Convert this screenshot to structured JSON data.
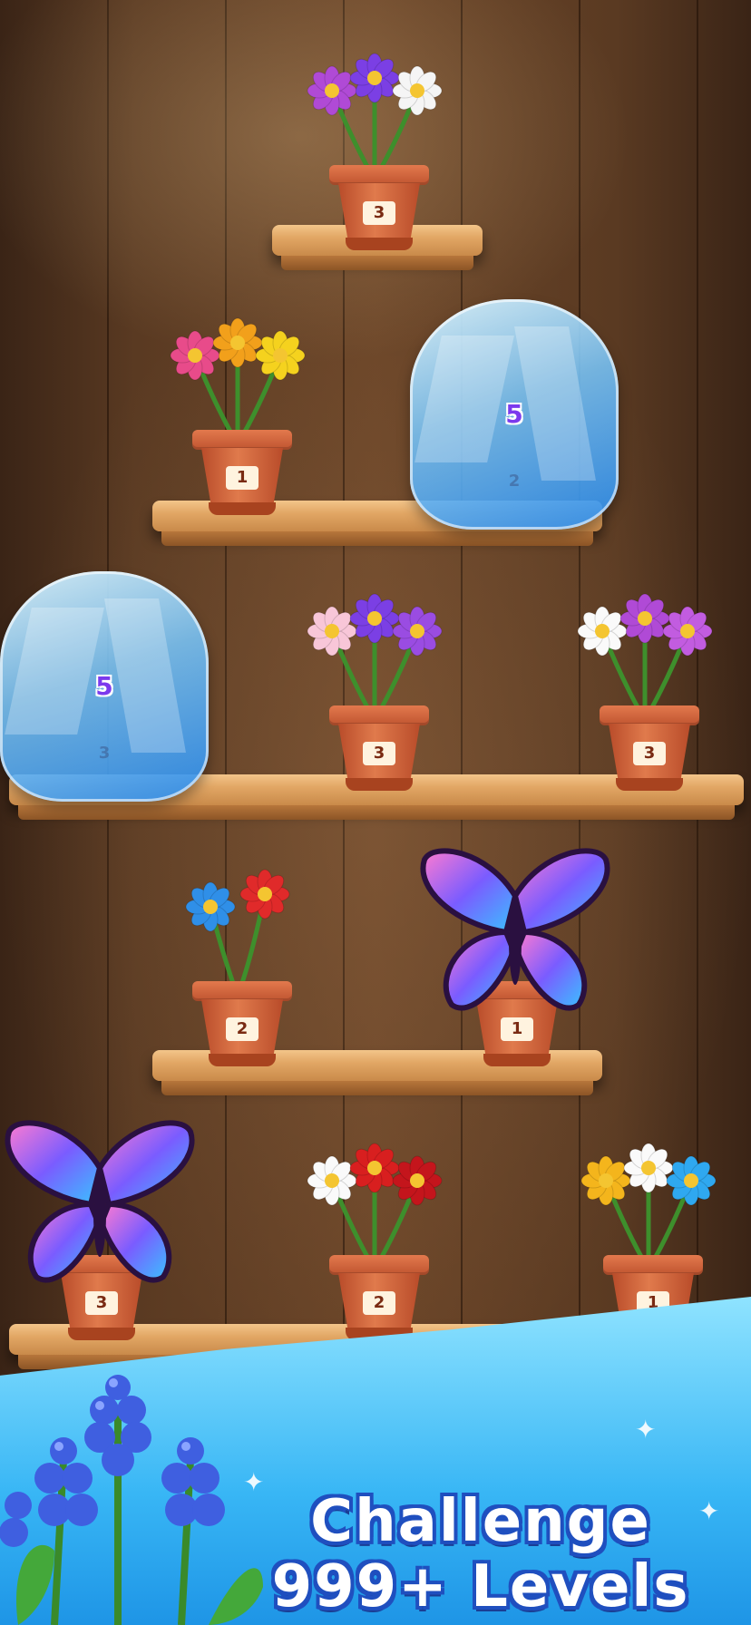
{
  "pots": [
    {
      "id": "top",
      "number": "3",
      "flowers": [
        "#b04ad6",
        "#7b3fe4",
        "#f5f5f5"
      ]
    },
    {
      "id": "row2-left",
      "number": "1",
      "flowers": [
        "#e84b8a",
        "#f2a01b",
        "#f5d21e"
      ]
    },
    {
      "id": "row3-mid",
      "number": "3",
      "flowers": [
        "#f8c6d8",
        "#7b3fe4",
        "#9a4ce2"
      ]
    },
    {
      "id": "row3-right",
      "number": "3",
      "flowers": [
        "#fafafa",
        "#b04ad6",
        "#c25ce0"
      ]
    },
    {
      "id": "row4-left",
      "number": "2",
      "flowers": [
        "#2f8fe8",
        "#e02a2a"
      ]
    },
    {
      "id": "row5-mid",
      "number": "2",
      "flowers": [
        "#fafafa",
        "#d81f1f",
        "#c4151c"
      ]
    },
    {
      "id": "row5-right",
      "number": "1",
      "flowers": [
        "#f4b51c",
        "#fafafa",
        "#2fa8f0"
      ]
    }
  ],
  "ice_blocks": [
    {
      "id": "ice-row2",
      "count": "5",
      "pot_number": "2"
    },
    {
      "id": "ice-row3",
      "count": "5",
      "pot_number": "3"
    }
  ],
  "butterfly_pots": [
    {
      "id": "bfly-row4",
      "pot_number": "1"
    },
    {
      "id": "bfly-row5",
      "pot_number": "3"
    }
  ],
  "banner": {
    "line1": "Challenge",
    "line2": "999+ Levels"
  },
  "colors": {
    "accent": "#1f4fbf",
    "shelf": "#e2a765",
    "pot": "#d9663a",
    "ice": "#4db2f5"
  }
}
